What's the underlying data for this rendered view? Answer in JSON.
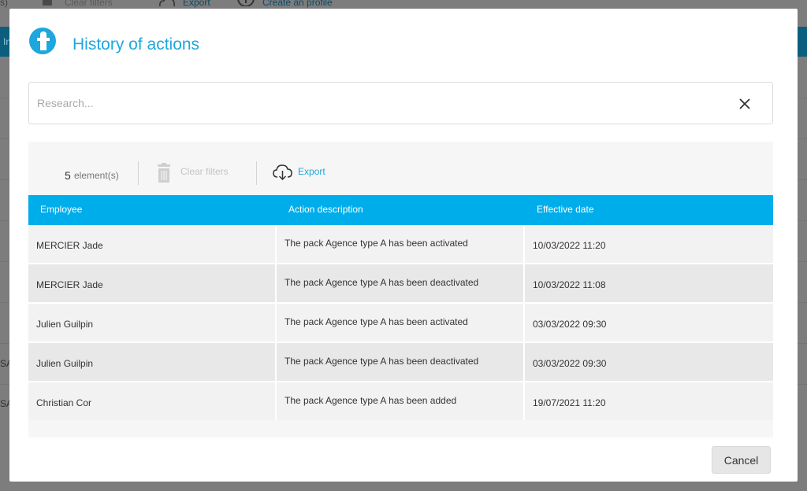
{
  "background": {
    "clear_filters": "Clear filters",
    "export": "Export",
    "create_profile": "Create an profile",
    "cut_left_1": "s)",
    "cut_left_2": "In",
    "cut_left_3": "SA",
    "cut_left_4": "SA"
  },
  "modal": {
    "title": "History of actions",
    "search_placeholder": "Research...",
    "toolbar": {
      "count": "5",
      "count_label": "element(s)",
      "clear_filters": "Clear filters",
      "export": "Export"
    },
    "table": {
      "columns": [
        "Employee",
        "Action description",
        "Effective date"
      ],
      "rows": [
        {
          "employee": "MERCIER Jade",
          "action": "The pack Agence type A has been activated",
          "date": "10/03/2022 11:20"
        },
        {
          "employee": "MERCIER Jade",
          "action": "The pack Agence type A has been deactivated",
          "date": "10/03/2022 11:08"
        },
        {
          "employee": "Julien Guilpin",
          "action": "The pack Agence type A has been activated",
          "date": "03/03/2022 09:30"
        },
        {
          "employee": "Julien Guilpin",
          "action": "The pack Agence type A has been deactivated",
          "date": "03/03/2022 09:30"
        },
        {
          "employee": "Christian Cor",
          "action": "The pack Agence type A has been added",
          "date": "19/07/2021 11:20"
        }
      ]
    },
    "cancel": "Cancel"
  },
  "colors": {
    "accent": "#1ea7dc",
    "header": "#00adeb",
    "overlay": "#7d7d7d"
  },
  "icons": [
    "brand-logo-icon",
    "close-icon",
    "trash-icon",
    "cloud-download-icon",
    "plus-circle-icon"
  ]
}
